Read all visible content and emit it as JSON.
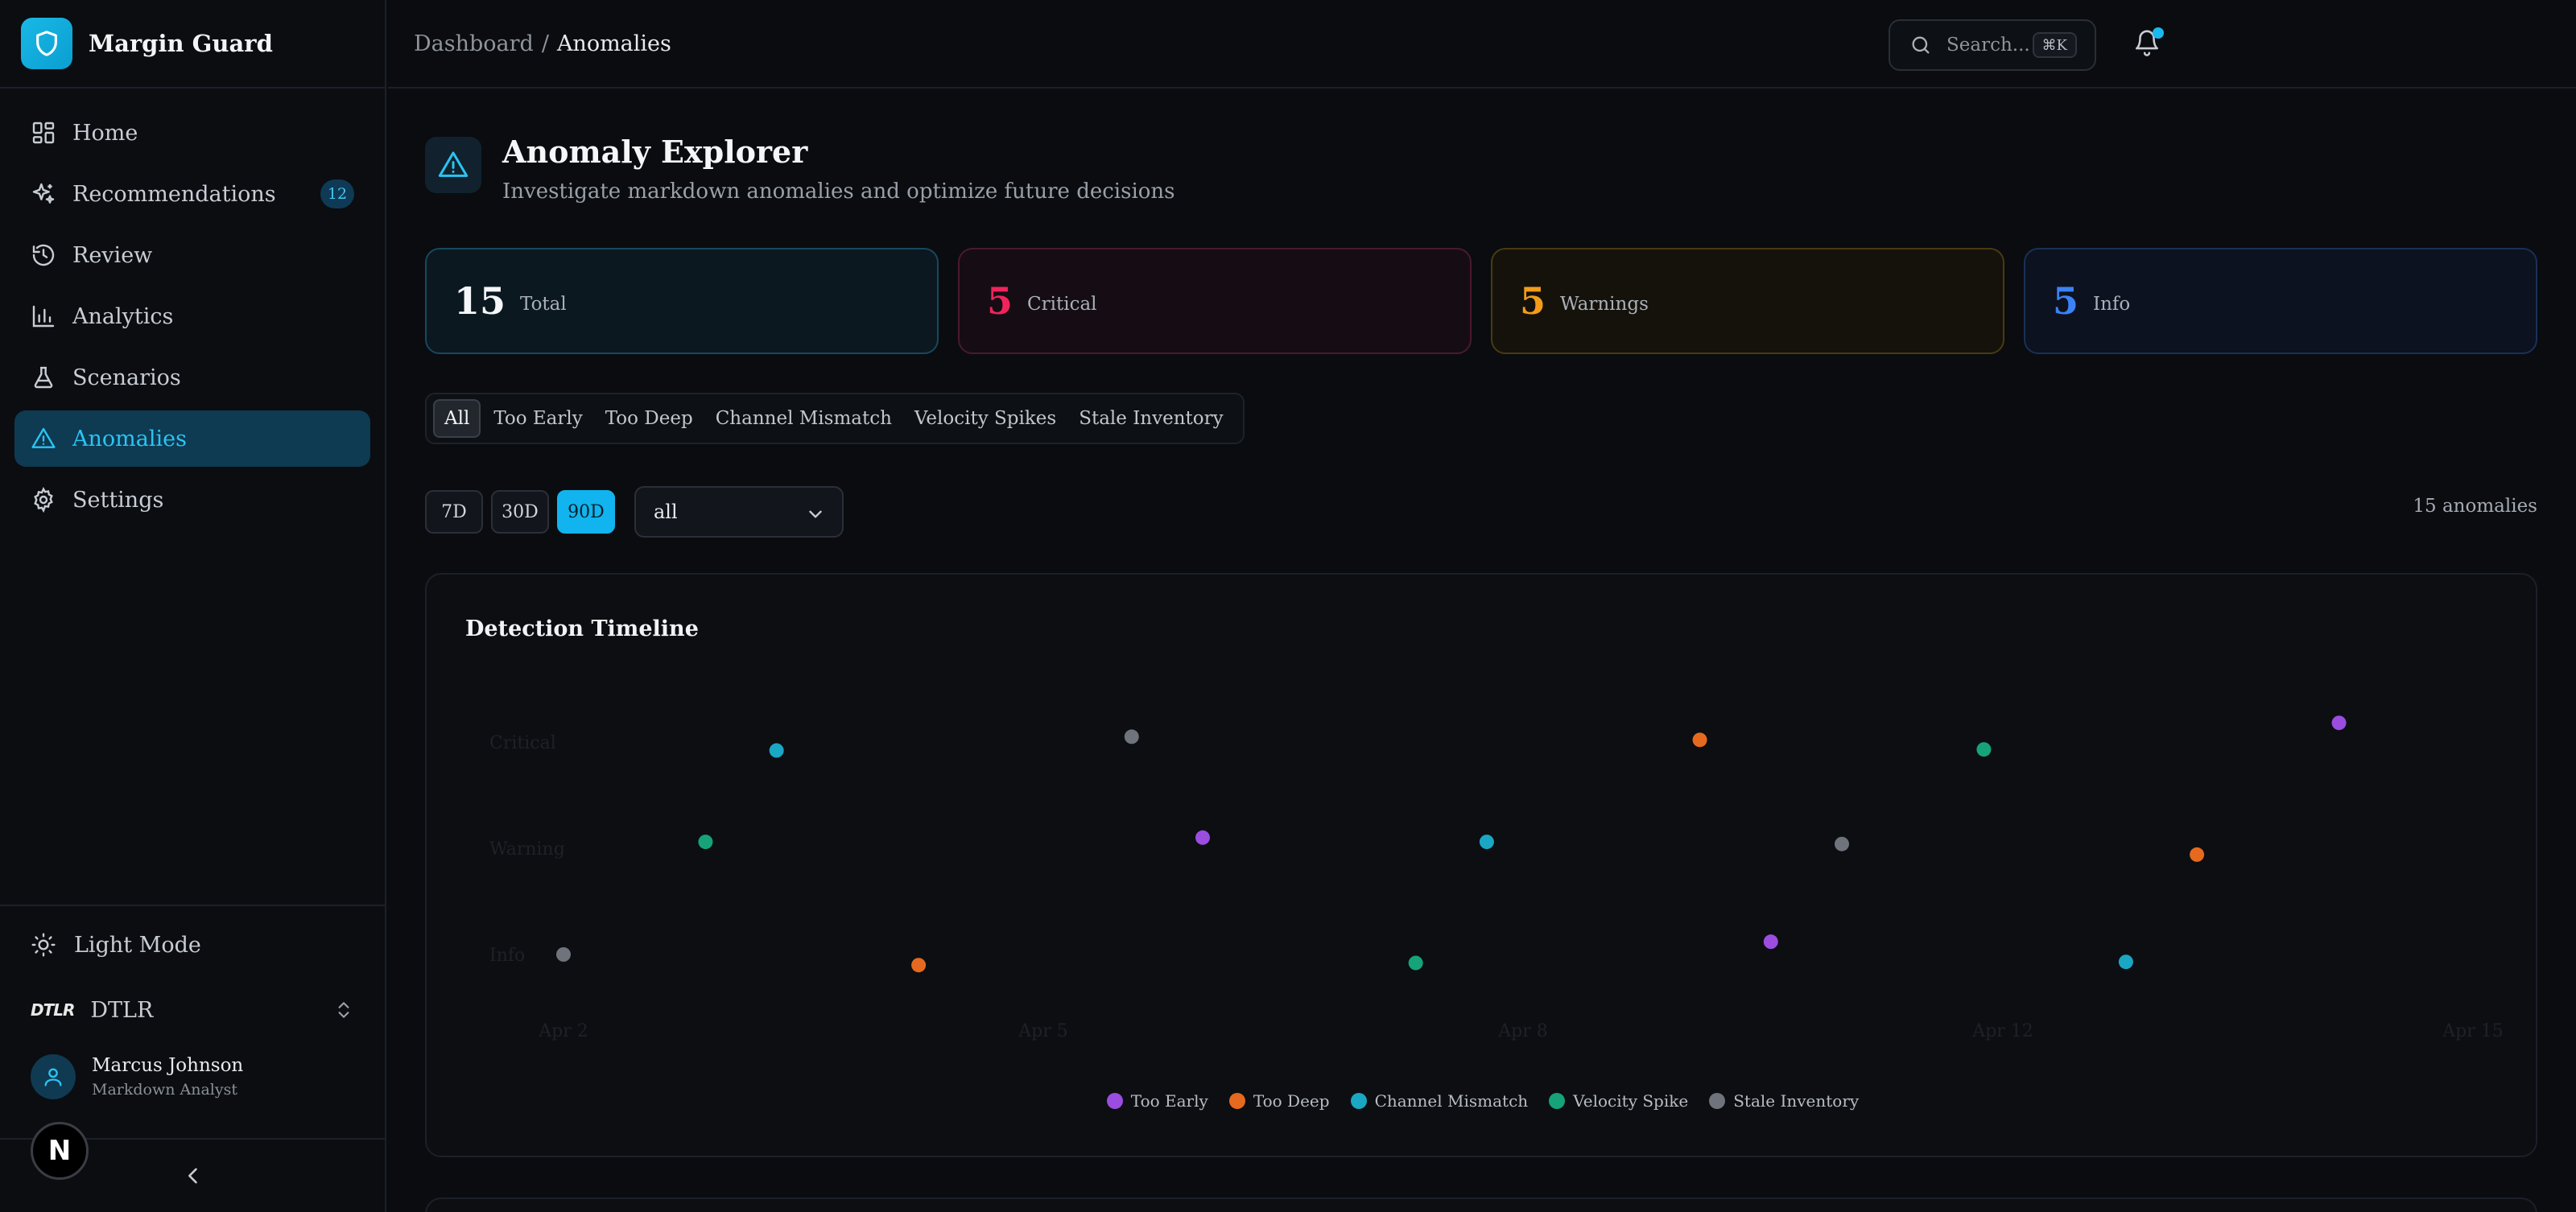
{
  "app": {
    "name": "Margin Guard"
  },
  "nav": {
    "items": [
      {
        "label": "Home",
        "icon": "dashboard-icon"
      },
      {
        "label": "Recommendations",
        "icon": "sparkles-icon",
        "badge": "12"
      },
      {
        "label": "Review",
        "icon": "history-icon"
      },
      {
        "label": "Analytics",
        "icon": "bar-chart-icon"
      },
      {
        "label": "Scenarios",
        "icon": "flask-icon"
      },
      {
        "label": "Anomalies",
        "icon": "alert-triangle-icon",
        "active": true
      },
      {
        "label": "Settings",
        "icon": "gear-icon"
      }
    ]
  },
  "sidebar_bottom": {
    "theme_label": "Light Mode",
    "org_logo": "DTLR",
    "org_name": "DTLR",
    "user_name": "Marcus Johnson",
    "user_role": "Markdown Analyst",
    "dev_badge": "N"
  },
  "header": {
    "breadcrumb_root": "Dashboard",
    "breadcrumb_sep": "/",
    "breadcrumb_current": "Anomalies",
    "search_placeholder": "Search...",
    "search_shortcut": "⌘K"
  },
  "page": {
    "title": "Anomaly Explorer",
    "subtitle": "Investigate markdown anomalies and optimize future decisions"
  },
  "stats": [
    {
      "value": "15",
      "label": "Total"
    },
    {
      "value": "5",
      "label": "Critical"
    },
    {
      "value": "5",
      "label": "Warnings"
    },
    {
      "value": "5",
      "label": "Info"
    }
  ],
  "filters": [
    "All",
    "Too Early",
    "Too Deep",
    "Channel Mismatch",
    "Velocity Spikes",
    "Stale Inventory"
  ],
  "active_filter": "All",
  "ranges": [
    "7D",
    "30D",
    "90D"
  ],
  "active_range": "90D",
  "select_value": "all",
  "count_label": "15 anomalies",
  "colors": {
    "accent": "#11b4ee",
    "critical": "#f0245c",
    "warning": "#f39c1b",
    "info": "#3b82f6"
  },
  "chart_data": {
    "type": "scatter",
    "title": "Detection Timeline",
    "y_categories": [
      "Info",
      "Warning",
      "Critical"
    ],
    "x_ticks": [
      "Apr 2",
      "Apr 5",
      "Apr 8",
      "Apr 12",
      "Apr 15"
    ],
    "series": [
      {
        "name": "Too Early",
        "color": "#9b4de0",
        "points": [
          [
            5.0,
            1.1
          ],
          [
            9.0,
            0.12
          ],
          [
            13.0,
            2.18
          ]
        ]
      },
      {
        "name": "Too Deep",
        "color": "#e56a1f",
        "points": [
          [
            3.0,
            -0.1
          ],
          [
            8.5,
            2.02
          ],
          [
            12.0,
            0.94
          ]
        ]
      },
      {
        "name": "Channel Mismatch",
        "color": "#1aa7c4",
        "points": [
          [
            2.0,
            1.92
          ],
          [
            7.0,
            1.06
          ],
          [
            11.5,
            -0.07
          ]
        ]
      },
      {
        "name": "Velocity Spike",
        "color": "#16a37a",
        "points": [
          [
            1.5,
            1.06
          ],
          [
            6.5,
            -0.08
          ],
          [
            10.5,
            1.93
          ]
        ]
      },
      {
        "name": "Stale Inventory",
        "color": "#6f737b",
        "points": [
          [
            0.5,
            0.0
          ],
          [
            4.5,
            2.05
          ],
          [
            9.5,
            1.04
          ]
        ]
      }
    ]
  }
}
